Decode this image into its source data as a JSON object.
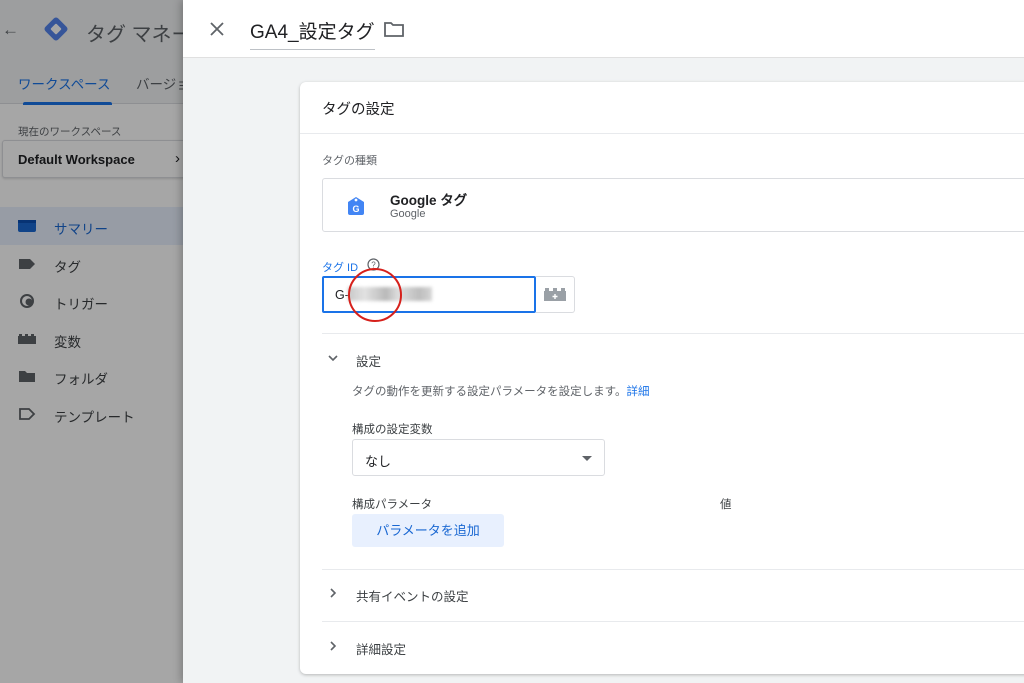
{
  "app": {
    "title": "タグ マネージャー",
    "tabs": [
      "ワークスペース",
      "バージョン"
    ],
    "current_workspace_label": "現在のワークスペース",
    "workspace_name": "Default Workspace",
    "nav": [
      {
        "label": "サマリー",
        "icon": "summary-icon",
        "active": true
      },
      {
        "label": "タグ",
        "icon": "tag-icon"
      },
      {
        "label": "トリガー",
        "icon": "trigger-icon"
      },
      {
        "label": "変数",
        "icon": "variable-icon"
      },
      {
        "label": "フォルダ",
        "icon": "folder-icon"
      },
      {
        "label": "テンプレート",
        "icon": "template-icon"
      }
    ]
  },
  "panel": {
    "tag_name": "GA4_設定タグ",
    "card_title": "タグの設定",
    "tag_type_label": "タグの種類",
    "tag_type": {
      "name": "Google タグ",
      "vendor": "Google"
    },
    "tag_id_label": "タグ ID",
    "tag_id_value": "G-",
    "settings": {
      "title": "設定",
      "description": "タグの動作を更新する設定パラメータを設定します。",
      "details_link": "詳細",
      "config_var_label": "構成の設定変数",
      "config_var_value": "なし",
      "params_label": "構成パラメータ",
      "value_label": "値",
      "add_param_button": "パラメータを追加"
    },
    "shared_events": "共有イベントの設定",
    "advanced": "詳細設定"
  },
  "colors": {
    "accent": "#1a73e8",
    "highlight_circle": "#d6201b"
  }
}
